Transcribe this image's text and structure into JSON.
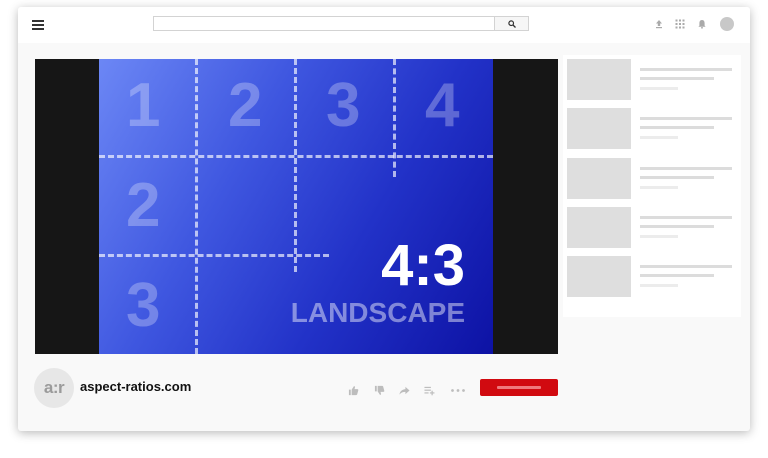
{
  "search": {
    "placeholder": ""
  },
  "video": {
    "grid_numbers": [
      "1",
      "2",
      "3",
      "4",
      "2",
      "3"
    ],
    "ratio_label": "4:3",
    "orientation_label": "LANDSCAPE",
    "gradient_colors": [
      "#6c87f5",
      "#0d12a4"
    ]
  },
  "channel": {
    "avatar_text": "a:r",
    "name": "aspect-ratios.com"
  },
  "actions": [
    "like-icon",
    "dislike-icon",
    "share-icon",
    "add-to-playlist-icon",
    "more-icon"
  ],
  "subscribe": {
    "color": "#d10a10"
  },
  "suggestions": {
    "count_visible": 5
  }
}
